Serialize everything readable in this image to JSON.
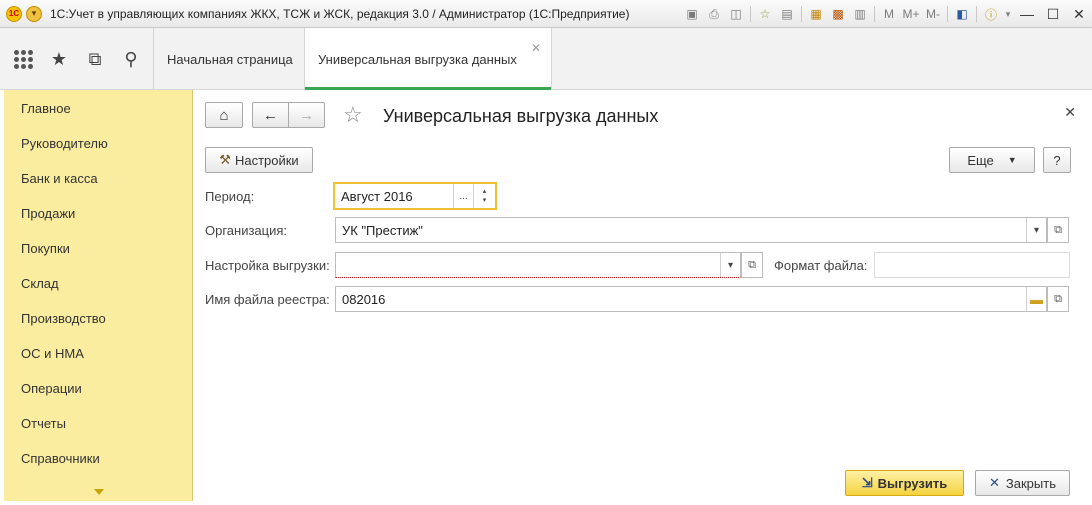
{
  "app": {
    "logo_text": "1С",
    "window_title": "1С:Учет в управляющих компаниях ЖКХ, ТСЖ и ЖСК, редакция 3.0 / Администратор  (1С:Предприятие)",
    "toolbar": {
      "m": "M",
      "mplus": "M+",
      "mminus": "M-"
    }
  },
  "tabs": [
    {
      "label": "Начальная страница"
    },
    {
      "label": "Универсальная выгрузка данных"
    }
  ],
  "sidebar": {
    "items": [
      {
        "label": "Главное"
      },
      {
        "label": "Руководителю"
      },
      {
        "label": "Банк и касса"
      },
      {
        "label": "Продажи"
      },
      {
        "label": "Покупки"
      },
      {
        "label": "Склад"
      },
      {
        "label": "Производство"
      },
      {
        "label": "ОС и НМА"
      },
      {
        "label": "Операции"
      },
      {
        "label": "Отчеты"
      },
      {
        "label": "Справочники"
      }
    ]
  },
  "form": {
    "title": "Универсальная выгрузка данных",
    "settings_button": "Настройки",
    "more_button": "Еще",
    "help_button": "?",
    "period_label": "Период:",
    "period_value": "Август 2016",
    "organization_label": "Организация:",
    "organization_value": "УК \"Престиж\"",
    "export_settings_label": "Настройка выгрузки:",
    "export_settings_value": "",
    "file_format_label": "Формат файла:",
    "file_format_value": "",
    "registry_filename_label": "Имя файла реестра:",
    "registry_filename_value": "082016",
    "export_button": "Выгрузить",
    "close_button": "Закрыть"
  },
  "colors": {
    "sidebar_bg": "#fbeda0",
    "active_tab_underline": "#3aa653",
    "focus_border": "#f0c030",
    "primary_button": "#f4d23f"
  }
}
